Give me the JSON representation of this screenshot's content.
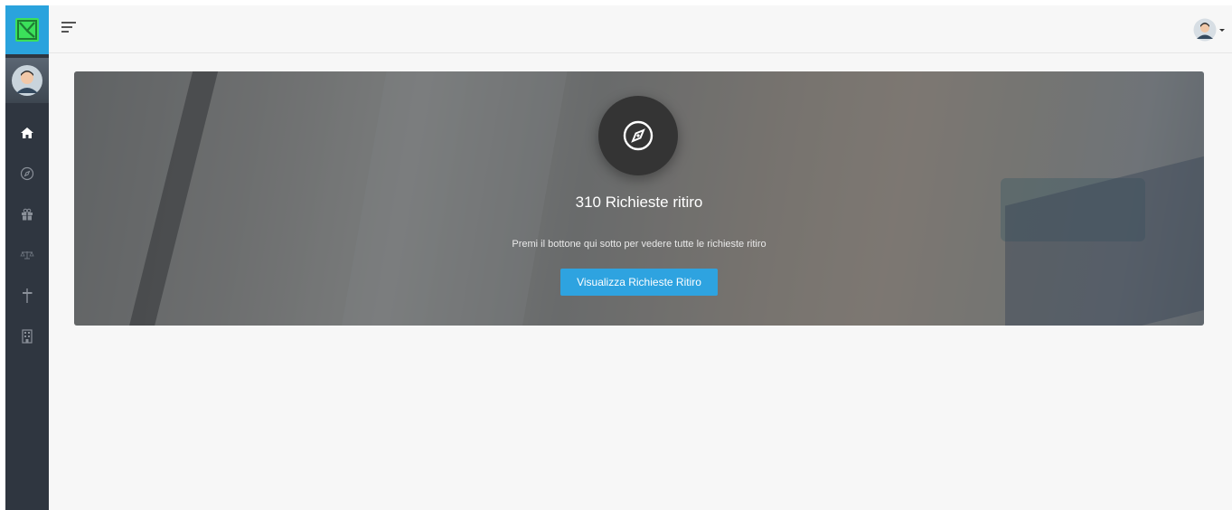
{
  "colors": {
    "sidebar_bg": "#2f3640",
    "brand_bg": "#2aa3dd",
    "logo_green": "#3be05a",
    "content_bg": "#f7f7f7",
    "button_bg": "#2ea3e0",
    "icon_circle_bg": "#343434"
  },
  "sidebar": {
    "logo_icon": "check-square-logo",
    "avatar_icon": "user-avatar",
    "items": [
      {
        "icon": "home-icon",
        "active": true
      },
      {
        "icon": "compass-icon",
        "active": false
      },
      {
        "icon": "gift-icon",
        "active": false
      },
      {
        "icon": "scale-icon",
        "active": false
      },
      {
        "icon": "signpost-icon",
        "active": false
      },
      {
        "icon": "building-icon",
        "active": false
      }
    ]
  },
  "topbar": {
    "menu_icon": "hamburger-icon",
    "user_icon": "user-avatar"
  },
  "hero": {
    "icon": "compass-icon",
    "title": "310 Richieste ritiro",
    "subtitle": "Premi il bottone qui sotto per vedere tutte le richieste ritiro",
    "button_label": "Visualizza Richieste Ritiro"
  }
}
